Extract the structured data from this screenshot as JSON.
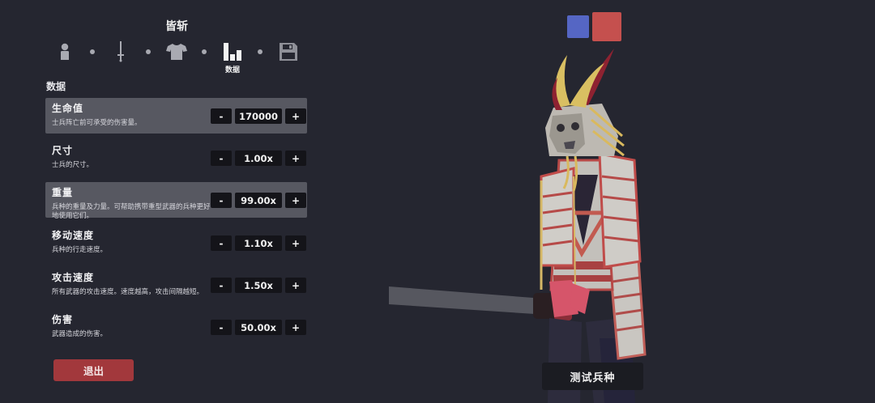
{
  "unit": {
    "name": "皆斩"
  },
  "tabs": [
    {
      "icon": "person-icon",
      "label": ""
    },
    {
      "icon": "sword-icon",
      "label": ""
    },
    {
      "icon": "shirt-icon",
      "label": ""
    },
    {
      "icon": "stats-bars-icon",
      "label": "数据",
      "active": true
    },
    {
      "icon": "save-icon",
      "label": ""
    }
  ],
  "section": {
    "title": "数据"
  },
  "stats": [
    {
      "name": "生命值",
      "desc": "士兵阵亡前可承受的伤害量。",
      "value": "170000",
      "minus": "-",
      "plus": "+",
      "highlighted": true
    },
    {
      "name": "尺寸",
      "desc": "士兵的尺寸。",
      "value": "1.00x",
      "minus": "-",
      "plus": "+",
      "highlighted": false
    },
    {
      "name": "重量",
      "desc": "兵种的重量及力量。可帮助携带重型武器的兵种更好地使用它们。",
      "value": "99.00x",
      "minus": "-",
      "plus": "+",
      "highlighted": true
    },
    {
      "name": "移动速度",
      "desc": "兵种的行走速度。",
      "value": "1.10x",
      "minus": "-",
      "plus": "+",
      "highlighted": false
    },
    {
      "name": "攻击速度",
      "desc": "所有武器的攻击速度。速度越高，攻击间隔越短。",
      "value": "1.50x",
      "minus": "-",
      "plus": "+",
      "highlighted": false
    },
    {
      "name": "伤害",
      "desc": "武器造成的伤害。",
      "value": "50.00x",
      "minus": "-",
      "plus": "+",
      "highlighted": false
    }
  ],
  "buttons": {
    "exit": "退出",
    "test_unit": "测试兵种"
  },
  "team_colors": {
    "blue": "#5566c4",
    "red": "#c5504e"
  },
  "colors": {
    "background": "#252630",
    "exit": "#a2383c",
    "highlight_row": "#575861"
  }
}
